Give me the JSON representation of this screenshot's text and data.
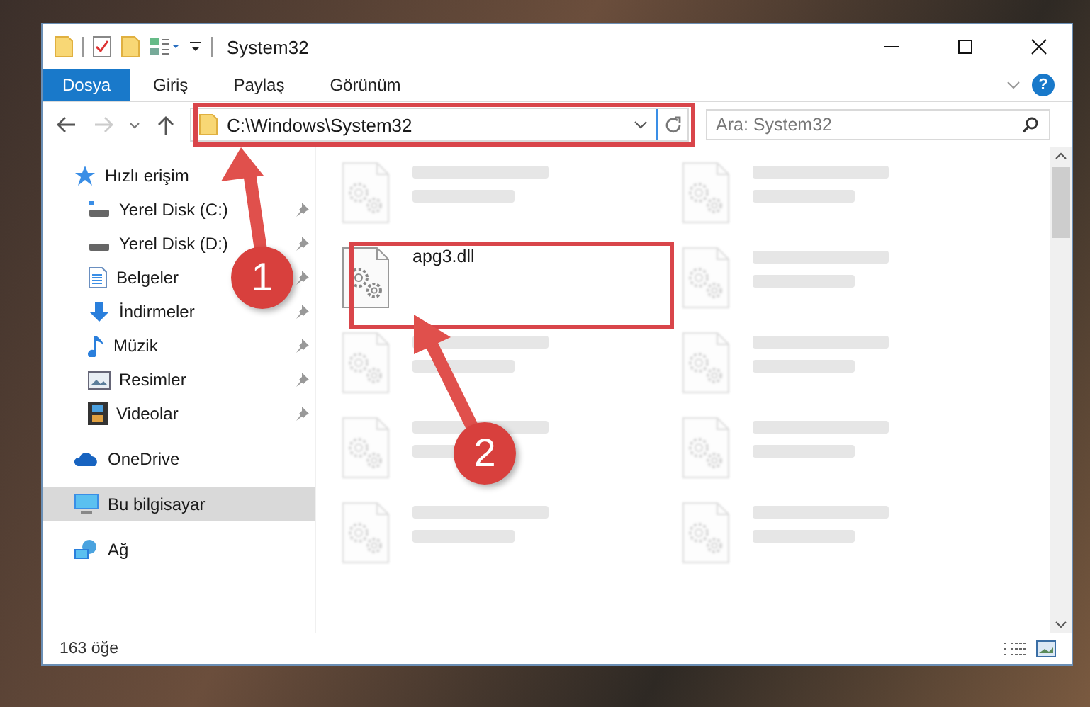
{
  "window": {
    "title": "System32"
  },
  "ribbon": {
    "tabs": [
      {
        "label": "Dosya",
        "selected": true
      },
      {
        "label": "Giriş",
        "selected": false
      },
      {
        "label": "Paylaş",
        "selected": false
      },
      {
        "label": "Görünüm",
        "selected": false
      }
    ],
    "help": "?"
  },
  "address": {
    "path": "C:\\Windows\\System32"
  },
  "search": {
    "placeholder": "Ara: System32"
  },
  "sidebar": {
    "items": [
      {
        "label": "Hızlı erişim",
        "selected": false,
        "children": [
          {
            "label": "Yerel Disk (C:)",
            "pinned": true
          },
          {
            "label": "Yerel Disk (D:)",
            "pinned": true
          },
          {
            "label": "Belgeler",
            "pinned": true
          },
          {
            "label": "İndirmeler",
            "pinned": true
          },
          {
            "label": "Müzik",
            "pinned": true
          },
          {
            "label": "Resimler",
            "pinned": true
          },
          {
            "label": "Videolar",
            "pinned": true
          }
        ]
      },
      {
        "label": "OneDrive",
        "selected": false
      },
      {
        "label": "Bu bilgisayar",
        "selected": true
      },
      {
        "label": "Ağ",
        "selected": false
      }
    ]
  },
  "files": [
    {
      "kind": "blurred"
    },
    {
      "kind": "blurred"
    },
    {
      "name": "apg3.dll",
      "kind": "focus"
    },
    {
      "kind": "blurred"
    },
    {
      "kind": "blurred"
    },
    {
      "kind": "blurred"
    },
    {
      "kind": "blurred"
    },
    {
      "kind": "blurred"
    },
    {
      "kind": "blurred"
    },
    {
      "kind": "blurred"
    }
  ],
  "status_bar": {
    "count": "163 öğe"
  },
  "annotations": [
    {
      "number": "1"
    },
    {
      "number": "2"
    }
  ]
}
